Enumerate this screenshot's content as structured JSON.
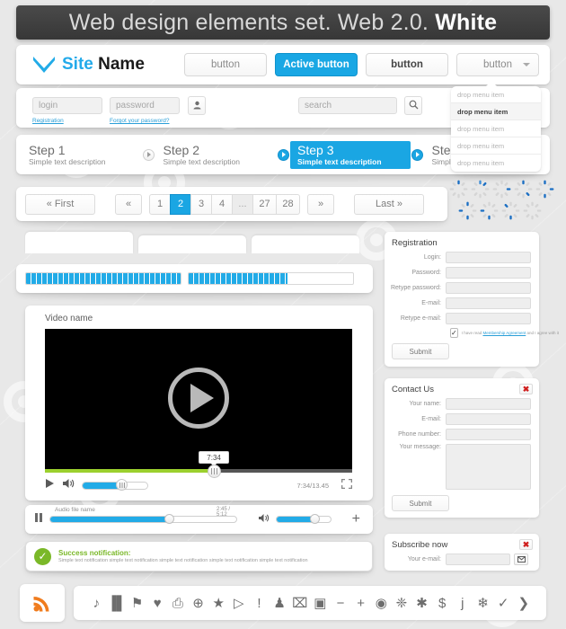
{
  "banner": {
    "text_normal": "Web design elements set. Web 2.0. ",
    "text_bold": "White"
  },
  "header": {
    "logo_icon": "envelope-m-logo-icon",
    "logo_part1": "Site",
    "logo_part2": "Name",
    "buttons": [
      {
        "label": "button",
        "state": "default"
      },
      {
        "label": "Active button",
        "state": "active"
      },
      {
        "label": "button",
        "state": "dark"
      },
      {
        "label": "button",
        "state": "split"
      }
    ]
  },
  "loginbar": {
    "login_placeholder": "login",
    "password_placeholder": "password",
    "user_icon": "user-icon",
    "registration_link": "Registration",
    "forgot_link": "Forgot your password?",
    "search_placeholder": "search",
    "search_icon": "search-icon"
  },
  "steps": [
    {
      "title": "Step 1",
      "desc": "Simple text description",
      "active": false
    },
    {
      "title": "Step 2",
      "desc": "Simple text description",
      "active": false
    },
    {
      "title": "Step 3",
      "desc": "Simple text description",
      "active": true
    },
    {
      "title": "Step 4",
      "desc": "Simple text description",
      "active": false
    }
  ],
  "pagination": {
    "first_label": "« First",
    "prev_label": "«",
    "next_label": "»",
    "last_label": "Last »",
    "pages": [
      "1",
      "2",
      "3",
      "4",
      "...",
      "27",
      "28"
    ],
    "current_page": "2"
  },
  "dropmenu": {
    "items": [
      {
        "label": "drop menu item",
        "selected": false
      },
      {
        "label": "drop menu item",
        "selected": true
      },
      {
        "label": "drop menu item",
        "selected": false
      },
      {
        "label": "drop menu item",
        "selected": false
      },
      {
        "label": "drop menu item",
        "selected": false
      }
    ]
  },
  "spinners": {
    "name": "loading-spinner",
    "row1_count": 5,
    "row2_count": 4
  },
  "tabs": [
    {
      "label": ""
    },
    {
      "label": ""
    },
    {
      "label": ""
    }
  ],
  "progress": {
    "bar1_percent": 100,
    "bar2_percent": 60
  },
  "video": {
    "title": "Video name",
    "play_icon": "play-icon",
    "tooltip_time": "7:34",
    "time_display": "7:34/13.45",
    "progress_percent": 55,
    "volume_percent": 60,
    "play_small_icon": "play-icon",
    "volume_icon": "volume-icon",
    "fullscreen_icon": "fullscreen-icon"
  },
  "audio": {
    "pause_icon": "pause-icon",
    "file_name": "Audio file name",
    "time_display": "2:45 / 5:12",
    "progress_percent": 64,
    "volume_icon": "volume-icon",
    "volume_percent": 60,
    "add_icon": "plus-icon"
  },
  "notification": {
    "check_icon": "check-circle-icon",
    "title": "Success notification:",
    "description": "Simple text notification simple text notification simple text notification simple text notification simple text notification"
  },
  "registration": {
    "title": "Registration",
    "fields": [
      {
        "label": "Login:",
        "value": ""
      },
      {
        "label": "Password:",
        "value": ""
      },
      {
        "label": "Retype password:",
        "value": ""
      },
      {
        "label": "E-mail:",
        "value": ""
      },
      {
        "label": "Retype e-mail:",
        "value": ""
      }
    ],
    "agree_pre": "I have read ",
    "agree_link": "Membership Agreement",
    "agree_post": " and I agree with it",
    "checkbox_checked": true,
    "submit_label": "Submit"
  },
  "contact": {
    "title": "Contact Us",
    "close_icon": "close-icon",
    "fields": [
      {
        "label": "Your name:",
        "value": ""
      },
      {
        "label": "E-mail:",
        "value": ""
      },
      {
        "label": "Phone number:",
        "value": ""
      }
    ],
    "message_label": "Your message:",
    "submit_label": "Submit"
  },
  "subscribe": {
    "title": "Subscribe now",
    "close_icon": "close-icon",
    "email_label": "Your e-mail:",
    "send_icon": "envelope-icon"
  },
  "footer": {
    "rss_icon": "rss-icon",
    "icons": [
      "music-note-icon",
      "chart-bars-icon",
      "tag-icon",
      "heart-icon",
      "printer-icon",
      "globe-icon",
      "star-icon",
      "video-camera-icon",
      "exclamation-icon",
      "user-icon",
      "trash-icon",
      "save-disk-icon",
      "minus-icon",
      "plus-icon",
      "eye-icon",
      "pin-icon",
      "asterisk-icon",
      "dollar-icon",
      "info-icon",
      "snowflake-icon",
      "check-icon",
      "arrow-right-icon"
    ],
    "glyphs": [
      "♪",
      "▐▌",
      "⚑",
      "♥",
      "⎙",
      "⊕",
      "★",
      "▷",
      "!",
      "♟",
      "⌧",
      "▣",
      "−",
      "+",
      "◉",
      "❈",
      "✱",
      "$",
      "ј",
      "❄",
      "✓",
      "❯"
    ]
  },
  "colors": {
    "accent_blue": "#1aa6e3",
    "banner_dark": "#3f3f3f",
    "success_green": "#7ab828",
    "video_progress_green": "#9bd02e",
    "close_red": "#d0201f",
    "rss_orange": "#f07c1e",
    "spinner_blue": "#1b6fc4"
  }
}
